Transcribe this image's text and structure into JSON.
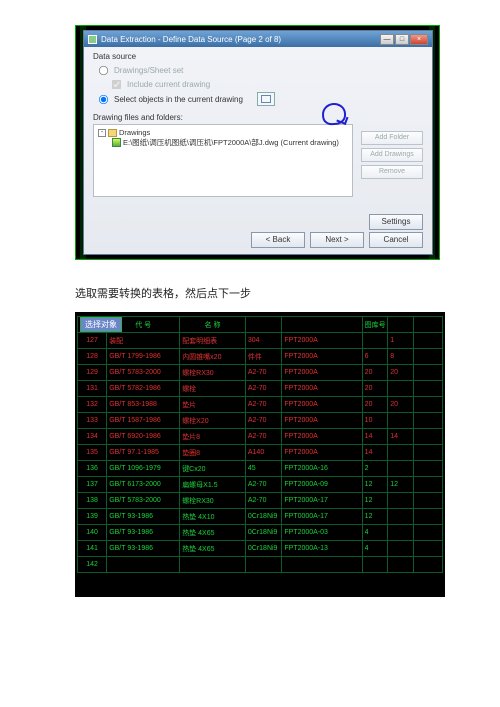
{
  "dialog": {
    "title": "Data Extraction - Define Data Source (Page 2 of 8)",
    "data_source_label": "Data source",
    "radio_sheet": "Drawings/Sheet set",
    "chk_include": "Include current drawing",
    "radio_select": "Select objects in the current drawing",
    "files_label": "Drawing files and folders:",
    "tree_root": "Drawings",
    "tree_child": "E:\\图纸\\调压机图纸\\调压机\\FPT2000A\\部J.dwg (Current drawing)",
    "btn_add_folder": "Add Folder",
    "btn_add_drawings": "Add Drawings",
    "btn_remove": "Remove",
    "btn_settings": "Settings",
    "btn_back": "< Back",
    "btn_next": "Next >",
    "btn_cancel": "Cancel",
    "win_min": "—",
    "win_max": "□",
    "win_close": "×"
  },
  "caption": "选取需要转换的表格，然后点下一步",
  "cad": {
    "select_label": "选择对象",
    "headers": [
      "",
      "代 号",
      "名 称",
      "",
      "",
      "图库号",
      "",
      ""
    ],
    "rows": [
      {
        "n": "127",
        "c1": "装配",
        "c2": "配套明细表",
        "c3": "304",
        "c4": "FPT2000A",
        "c5": "",
        "c6": "1",
        "cls": "r"
      },
      {
        "n": "128",
        "c1": "GB/T 1799-1986",
        "c2": "内圆锥嘴x20",
        "c3": "件件",
        "c4": "FPT2000A",
        "c5": "6",
        "c6": "8",
        "cls": "r"
      },
      {
        "n": "129",
        "c1": "GB/T 5783-2000",
        "c2": "螺栓RX30",
        "c3": "A2-70",
        "c4": "FPT2000A",
        "c5": "20",
        "c6": "20",
        "cls": "r"
      },
      {
        "n": "131",
        "c1": "GB/T 5782-1986",
        "c2": "螺栓",
        "c3": "A2-70",
        "c4": "FPT2000A",
        "c5": "20",
        "c6": "",
        "cls": "r"
      },
      {
        "n": "132",
        "c1": "GB/T 853-1988",
        "c2": "垫片",
        "c3": "A2-70",
        "c4": "FPT2000A",
        "c5": "20",
        "c6": "20",
        "cls": "r"
      },
      {
        "n": "133",
        "c1": "GB/T 1587-1986",
        "c2": "螺栓X20",
        "c3": "A2-70",
        "c4": "FPT2000A",
        "c5": "10",
        "c6": "",
        "cls": "r"
      },
      {
        "n": "134",
        "c1": "GB/T 6920-1986",
        "c2": "垫片8",
        "c3": "A2-70",
        "c4": "FPT2000A",
        "c5": "14",
        "c6": "14",
        "cls": "r"
      },
      {
        "n": "135",
        "c1": "GB/T 97.1-1985",
        "c2": "垫圈8",
        "c3": "A140",
        "c4": "FPT2000A",
        "c5": "14",
        "c6": "",
        "cls": "r"
      },
      {
        "n": "136",
        "c1": "GB/T 1096-1979",
        "c2": "键Cx20",
        "c3": "45",
        "c4": "FPT2000A-16",
        "c5": "2",
        "c6": "",
        "cls": "g"
      },
      {
        "n": "137",
        "c1": "GB/T 6173-2000",
        "c2": "扁螺母X1.5",
        "c3": "A2-70",
        "c4": "FPT2000A-09",
        "c5": "12",
        "c6": "12",
        "cls": "g"
      },
      {
        "n": "138",
        "c1": "GB/T 5783-2000",
        "c2": "螺栓RX30",
        "c3": "A2-70",
        "c4": "FPT2000A-17",
        "c5": "12",
        "c6": "",
        "cls": "g"
      },
      {
        "n": "139",
        "c1": "GB/T 93-1986",
        "c2": "热垫 4X10",
        "c3": "0Cr18Ni9",
        "c4": "FPT0000A-17",
        "c5": "12",
        "c6": "",
        "cls": "g"
      },
      {
        "n": "140",
        "c1": "GB/T 93-1986",
        "c2": "热垫 4X65",
        "c3": "0Cr18Ni9",
        "c4": "FPT2000A-03",
        "c5": "4",
        "c6": "",
        "cls": "g"
      },
      {
        "n": "141",
        "c1": "GB/T 93-1986",
        "c2": "热垫 4X65",
        "c3": "0Cr18Ni9",
        "c4": "FPT2000A-13",
        "c5": "4",
        "c6": "",
        "cls": "g"
      },
      {
        "n": "142",
        "c1": "",
        "c2": "",
        "c3": "",
        "c4": "",
        "c5": "",
        "c6": "",
        "cls": "g"
      }
    ]
  }
}
